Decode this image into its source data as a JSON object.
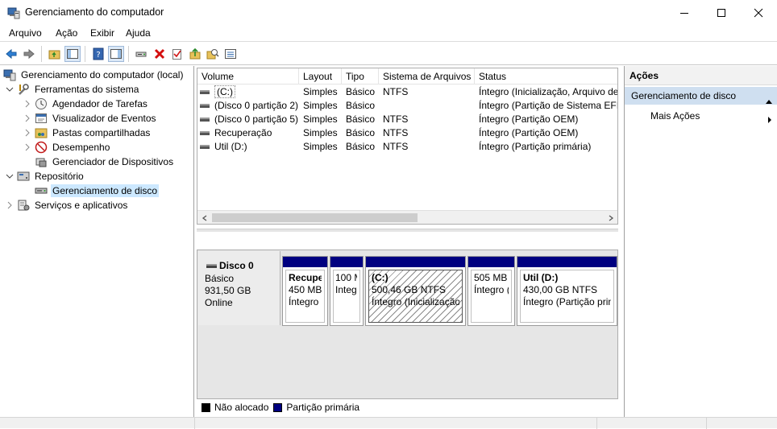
{
  "window": {
    "title": "Gerenciamento do computador"
  },
  "menu": [
    "Arquivo",
    "Ação",
    "Exibir",
    "Ajuda"
  ],
  "tree": {
    "root": "Gerenciamento do computador (local)",
    "system_tools": "Ferramentas do sistema",
    "system_tools_items": [
      "Agendador de Tarefas",
      "Visualizador de Eventos",
      "Pastas compartilhadas",
      "Desempenho",
      "Gerenciador de Dispositivos"
    ],
    "storage": "Repositório",
    "disk_management": "Gerenciamento de disco",
    "services": "Serviços e aplicativos"
  },
  "volumes": {
    "headers": [
      "Volume",
      "Layout",
      "Tipo",
      "Sistema de Arquivos",
      "Status"
    ],
    "rows": [
      [
        "(C:)",
        "Simples",
        "Básico",
        "NTFS",
        "Íntegro (Inicialização, Arquivo de"
      ],
      [
        "(Disco 0 partição 2)",
        "Simples",
        "Básico",
        "",
        "Íntegro (Partição de Sistema EFI)"
      ],
      [
        "(Disco 0 partição 5)",
        "Simples",
        "Básico",
        "NTFS",
        "Íntegro (Partição OEM)"
      ],
      [
        "Recuperação",
        "Simples",
        "Básico",
        "NTFS",
        "Íntegro (Partição OEM)"
      ],
      [
        "Util (D:)",
        "Simples",
        "Básico",
        "NTFS",
        "Íntegro (Partição primária)"
      ]
    ]
  },
  "disk": {
    "name": "Disco 0",
    "type": "Básico",
    "size": "931,50 GB",
    "state": "Online",
    "partitions": [
      {
        "name": "Recupe",
        "size": "450 MB",
        "status": "Íntegro ("
      },
      {
        "name": "",
        "size": "100 M",
        "status": "Integ"
      },
      {
        "name": "(C:)",
        "size": "500,46 GB NTFS",
        "status": "Íntegro (Inicialização,"
      },
      {
        "name": "",
        "size": "505 MB I",
        "status": "Íntegro ("
      },
      {
        "name": "Util  (D:)",
        "size": "430,00 GB NTFS",
        "status": "Íntegro (Partição prim"
      }
    ]
  },
  "legend": {
    "unallocated": "Não alocado",
    "primary": "Partição primária",
    "unallocated_color": "#000000",
    "primary_color": "#000080"
  },
  "actions": {
    "title": "Ações",
    "group": "Gerenciamento de disco",
    "more": "Mais Ações"
  }
}
